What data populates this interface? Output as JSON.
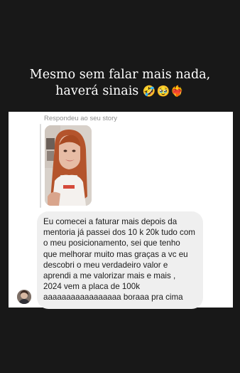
{
  "caption": {
    "text": "Mesmo sem falar mais nada,\nhaverá sinais",
    "emojis": "🤣🥹❤️‍🔥"
  },
  "dm": {
    "replied_label": "Respondeu ao seu story",
    "message": "Eu comecei a faturar mais depois da mentoria já passei dos 10 k 20k tudo com o meu posicionamento, sei que tenho que melhorar muito mas graças a vc eu descobri o meu verdadeiro valor e aprendi a me valorizar mais e mais , 2024 vem a placa de 100k aaaaaaaaaaaaaaaaa boraaa pra cima"
  },
  "colors": {
    "background": "#181818",
    "panel": "#ffffff",
    "bubble": "#efefef"
  }
}
